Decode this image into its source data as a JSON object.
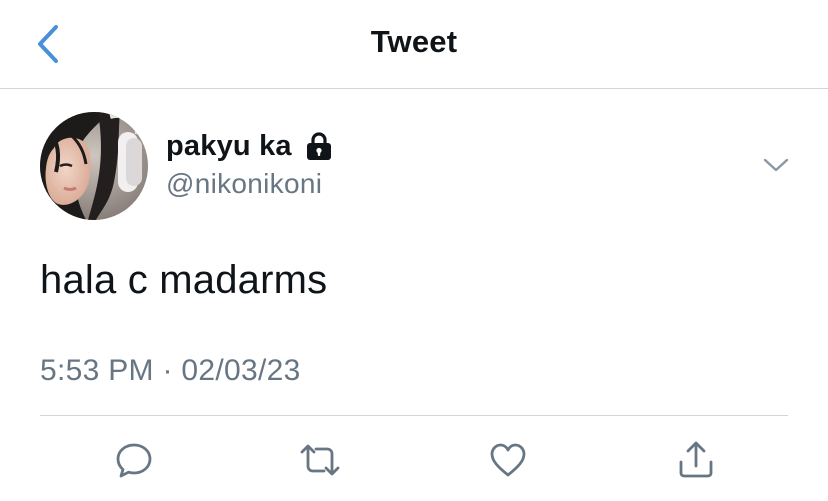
{
  "header": {
    "title": "Tweet",
    "back_icon": "chevron-left-icon",
    "accent_color": "#4a90d9"
  },
  "tweet": {
    "author": {
      "display_name": "pakyu ka",
      "username": "@nikonikoni",
      "protected_icon": "lock-icon",
      "avatar": "profile-photo"
    },
    "text": "hala c madarms",
    "meta": "5:53 PM · 02/03/23",
    "menu_icon": "chevron-down-icon"
  },
  "actions": [
    {
      "name": "reply",
      "icon": "speech-bubble-icon"
    },
    {
      "name": "retweet",
      "icon": "retweet-arrows-icon"
    },
    {
      "name": "like",
      "icon": "heart-icon"
    },
    {
      "name": "share",
      "icon": "share-upload-icon"
    }
  ],
  "colors": {
    "text_primary": "#0f1419",
    "text_secondary": "#687684",
    "divider": "#d4d4d8",
    "icon_gray": "#687684"
  }
}
